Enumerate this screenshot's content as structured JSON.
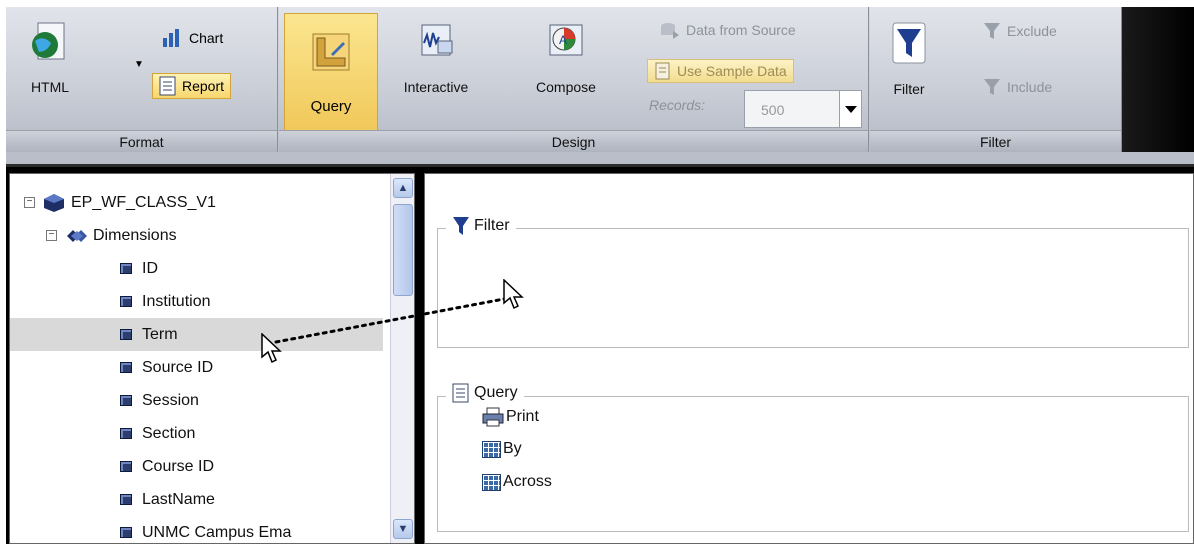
{
  "ribbon": {
    "groups": {
      "format": {
        "label": "Format"
      },
      "design": {
        "label": "Design"
      },
      "filter": {
        "label": "Filter"
      }
    },
    "format": {
      "html": "HTML",
      "chart": "Chart",
      "report": "Report"
    },
    "design": {
      "query": "Query",
      "interactive": "Interactive",
      "compose": "Compose",
      "data_from_source": "Data from Source",
      "use_sample_data": "Use Sample Data",
      "records_label": "Records:",
      "records_value": "500"
    },
    "filter": {
      "filter": "Filter",
      "exclude": "Exclude",
      "include": "Include"
    }
  },
  "tree": {
    "root": "EP_WF_CLASS_V1",
    "dimensions": "Dimensions",
    "fields": [
      "ID",
      "Institution",
      "Term",
      "Source ID",
      "Session",
      "Section",
      "Course ID",
      "LastName",
      "UNMC Campus Ema"
    ],
    "selected": "Term"
  },
  "panels": {
    "filter": {
      "title": "Filter"
    },
    "query": {
      "title": "Query",
      "items": [
        "Print",
        "By",
        "Across"
      ]
    }
  },
  "colors": {
    "accent_active": "#f1c85a",
    "field_icon": "#2c3e6e",
    "selected_row": "#d9d9d9"
  }
}
